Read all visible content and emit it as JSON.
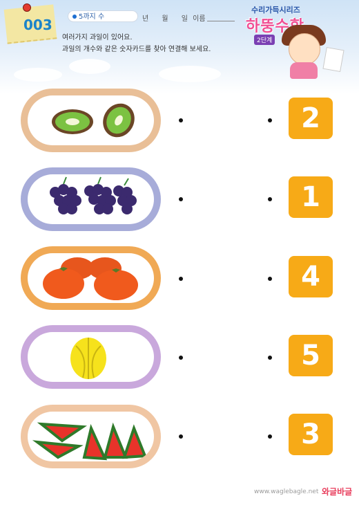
{
  "header": {
    "page_number": "003",
    "title_chip": "5까지 수",
    "date_labels": [
      "년",
      "월",
      "일"
    ],
    "name_label": "이름",
    "instructions": [
      "여러가지 과일이 있어요.",
      "과일의 개수와 같은 숫자카드를 찾아 연결해 보세요."
    ],
    "series_label": "수리가득시리즈",
    "brand": "하뚱수학",
    "level": "2단계"
  },
  "rows": [
    {
      "fruit": "kiwi",
      "card": "2",
      "tray_color": "#e9bf97"
    },
    {
      "fruit": "grapes",
      "card": "1",
      "tray_color": "#a7acd9"
    },
    {
      "fruit": "persimmon",
      "card": "4",
      "tray_color": "#f0a955"
    },
    {
      "fruit": "starfruit",
      "card": "5",
      "tray_color": "#c9a8dc"
    },
    {
      "fruit": "watermelon",
      "card": "3",
      "tray_color": "#f0c6a3"
    }
  ],
  "footer": {
    "url": "www.waglebagle.net",
    "logo": "와글바글"
  },
  "colors": {
    "card": "#f7aa17",
    "page_number": "#1c84c9"
  }
}
